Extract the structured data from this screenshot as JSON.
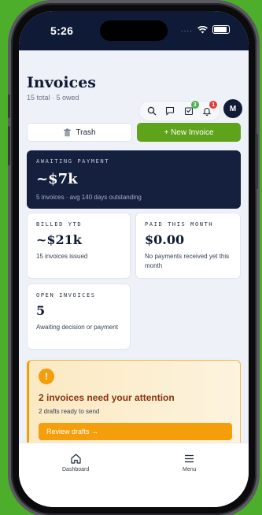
{
  "status_bar": {
    "time": "5:26",
    "signal": "...."
  },
  "header": {
    "title": "Invoices",
    "subtitle": "15 total · 5 owed",
    "badges": {
      "inbox": "3",
      "notifications": "1"
    },
    "avatar_initial": "M"
  },
  "actions": {
    "trash_label": "Trash",
    "new_invoice_label": "+ New Invoice"
  },
  "awaiting": {
    "label": "AWAITING PAYMENT",
    "amount": "~$7k",
    "meta": "5 invoices · avg 140 days outstanding"
  },
  "billed": {
    "label": "BILLED YTD",
    "amount": "~$21k",
    "desc": "15 invoices issued"
  },
  "paid": {
    "label": "PAID THIS MONTH",
    "amount": "$0.00",
    "desc": "No payments received yet this month"
  },
  "open": {
    "label": "OPEN INVOICES",
    "amount": "5",
    "desc": "Awaiting decision or payment"
  },
  "attention": {
    "icon": "!",
    "title": "2 invoices need your attention",
    "subtitle": "2 drafts ready to send",
    "button": "Review drafts →"
  },
  "tabbar": {
    "dashboard": "Dashboard",
    "menu": "Menu"
  },
  "colors": {
    "accent_green": "#5ea31a",
    "warning": "#f59e0b",
    "navy": "#15203f",
    "badge_green": "#4caf50",
    "badge_red": "#e53935"
  }
}
